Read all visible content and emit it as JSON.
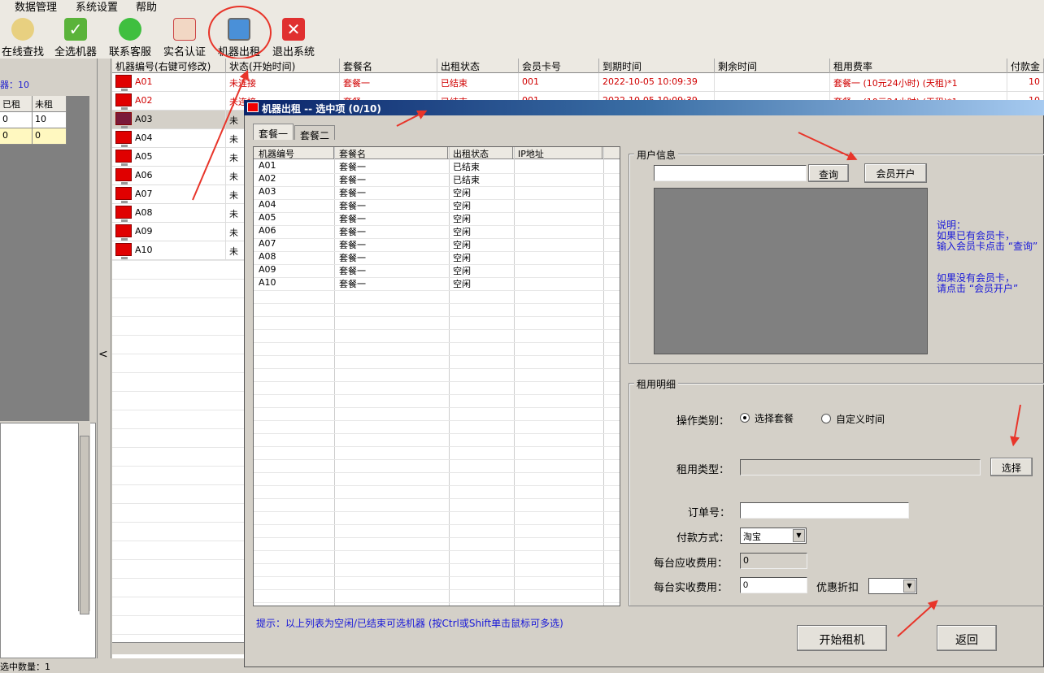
{
  "menu": [
    "数据管理",
    "系统设置",
    "帮助"
  ],
  "toolbar": [
    {
      "label": "在线查找",
      "icon": "search-icon"
    },
    {
      "label": "全选机器",
      "icon": "check-icon"
    },
    {
      "label": "联系客服",
      "icon": "chat-icon"
    },
    {
      "label": "实名认证",
      "icon": "id-card-icon"
    },
    {
      "label": "机器出租",
      "icon": "monitor-icon"
    },
    {
      "label": "退出系统",
      "icon": "close-icon"
    }
  ],
  "left": {
    "machine_count_label": "器：10",
    "table_headers": [
      "已租",
      "未租"
    ],
    "rows": [
      [
        "0",
        "10"
      ],
      [
        "0",
        "0"
      ]
    ],
    "selected_count": "选中数量：1"
  },
  "collapse_symbol": "<",
  "main": {
    "headers": [
      "机器编号(右键可修改)",
      "状态(开始时间)",
      "套餐名",
      "出租状态",
      "会员卡号",
      "到期时间",
      "剩余时间",
      "租用费率",
      "付款金"
    ],
    "rows": [
      {
        "id": "A01",
        "status": "未连接",
        "plan": "套餐一",
        "rent": "已结束",
        "card": "001",
        "expire": "2022-10-05 10:09:39",
        "remain": "",
        "rate": "套餐一 (10元24小时) (天租)*1",
        "pay": "10"
      },
      {
        "id": "A02",
        "status": "未连接",
        "plan": "套餐一",
        "rent": "已结束",
        "card": "001",
        "expire": "2022-10-05 10:09:39",
        "remain": "",
        "rate": "套餐一 (10元24小时) (天租)*1",
        "pay": "10"
      },
      {
        "id": "A03",
        "status": "未"
      },
      {
        "id": "A04",
        "status": "未"
      },
      {
        "id": "A05",
        "status": "未"
      },
      {
        "id": "A06",
        "status": "未"
      },
      {
        "id": "A07",
        "status": "未"
      },
      {
        "id": "A08",
        "status": "未"
      },
      {
        "id": "A09",
        "status": "未"
      },
      {
        "id": "A10",
        "status": "未"
      }
    ]
  },
  "dialog": {
    "title": "机器出租 -- 选中项 (0/10)",
    "tabs": [
      "套餐一",
      "套餐二"
    ],
    "list_headers": [
      "机器编号",
      "套餐名",
      "出租状态",
      "IP地址"
    ],
    "list_rows": [
      [
        "A01",
        "套餐一",
        "已结束",
        ""
      ],
      [
        "A02",
        "套餐一",
        "已结束",
        ""
      ],
      [
        "A03",
        "套餐一",
        "空闲",
        ""
      ],
      [
        "A04",
        "套餐一",
        "空闲",
        ""
      ],
      [
        "A05",
        "套餐一",
        "空闲",
        ""
      ],
      [
        "A06",
        "套餐一",
        "空闲",
        ""
      ],
      [
        "A07",
        "套餐一",
        "空闲",
        ""
      ],
      [
        "A08",
        "套餐一",
        "空闲",
        ""
      ],
      [
        "A09",
        "套餐一",
        "空闲",
        ""
      ],
      [
        "A10",
        "套餐一",
        "空闲",
        ""
      ]
    ],
    "user_info": {
      "title": "用户信息",
      "search_value": "",
      "query_button": "查询",
      "register_button": "会员开户",
      "note_lines": [
        "说明：",
        "如果已有会员卡，",
        "输入会员卡点击 “查询”",
        "",
        "如果没有会员卡，",
        "请点击 “会员开户”"
      ]
    },
    "rent_detail": {
      "title": "租用明细",
      "op_label": "操作类别：",
      "op_option1": "选择套餐",
      "op_option2": "自定义时间",
      "rent_type_label": "租用类型：",
      "rent_type_value": "",
      "choose_button": "选择",
      "order_label": "订单号：",
      "order_value": "",
      "pay_method_label": "付款方式：",
      "pay_method_value": "淘宝",
      "due_label": "每台应收费用：",
      "due_value": "0",
      "actual_label": "每台实收费用：",
      "actual_value": "0",
      "discount_label": "优惠折扣",
      "discount_value": ""
    },
    "hint": "提示：以上列表为空闲/已结束可选机器 (按Ctrl或Shift单击鼠标可多选)",
    "start_button": "开始租机",
    "back_button": "返回"
  },
  "colors": {
    "accent_red": "#e8352a",
    "status_red": "#d00000",
    "title_blue": "#0a246a",
    "hint_blue": "#1818d8"
  }
}
